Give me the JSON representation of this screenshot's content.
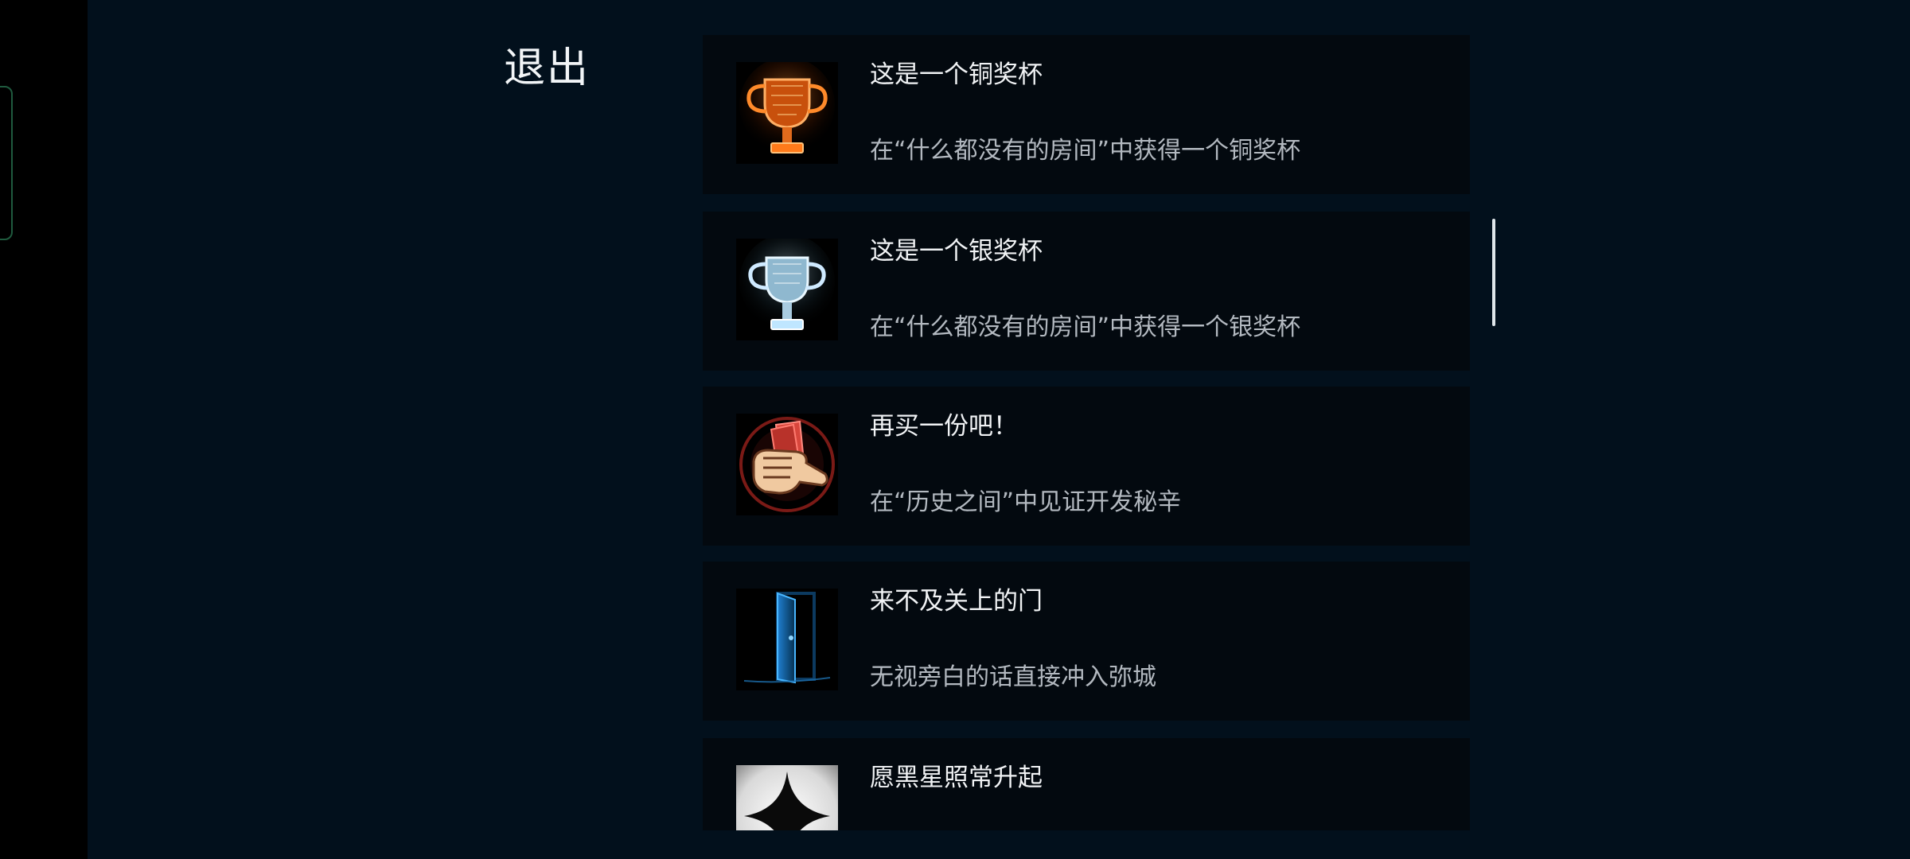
{
  "header": {
    "exit_label": "退出"
  },
  "achievements": [
    {
      "title": "这是一个铜奖杯",
      "description": "在“什么都没有的房间”中获得一个铜奖杯",
      "icon": "bronze-trophy-icon",
      "accent": "#ff7a1a"
    },
    {
      "title": "这是一个银奖杯",
      "description": "在“什么都没有的房间”中获得一个银奖杯",
      "icon": "silver-trophy-icon",
      "accent": "#bfe6ff"
    },
    {
      "title": "再买一份吧！",
      "description": "在“历史之间”中见证开发秘辛",
      "icon": "fist-money-icon",
      "accent": "#e0413c"
    },
    {
      "title": "来不及关上的门",
      "description": "无视旁白的话直接冲入弥城",
      "icon": "door-icon",
      "accent": "#2aa4ff"
    },
    {
      "title": "愿黑星照常升起",
      "description": "",
      "icon": "black-star-icon",
      "accent": "#000000"
    }
  ],
  "colors": {
    "background": "#02101c",
    "card": "#03090f",
    "title_text": "#f1f3f5",
    "desc_text": "#b3b9c0"
  }
}
